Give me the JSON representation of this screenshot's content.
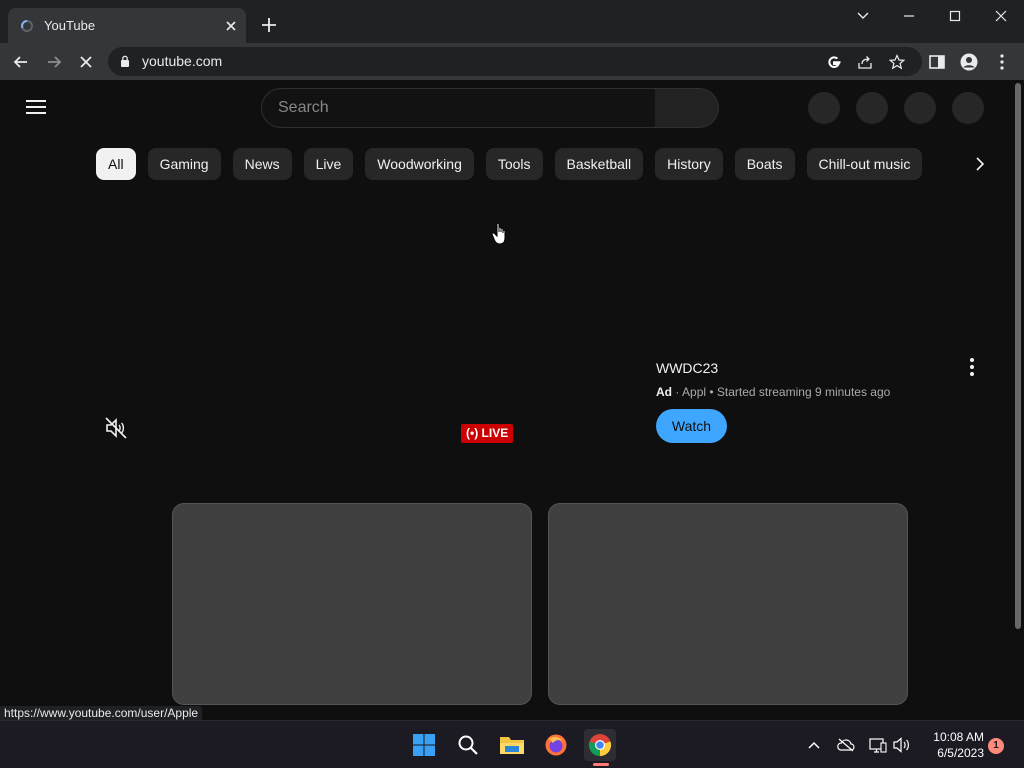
{
  "browser": {
    "tab_title": "YouTube",
    "url": "youtube.com"
  },
  "youtube": {
    "search_placeholder": "Search",
    "chips": [
      "All",
      "Gaming",
      "News",
      "Live",
      "Woodworking",
      "Tools",
      "Basketball",
      "History",
      "Boats",
      "Chill-out music"
    ],
    "active_chip": "All",
    "ad": {
      "title": "WWDC23",
      "label": "Ad",
      "separator": "·",
      "meta": "Appl • Started streaming 9 minutes ago",
      "cta": "Watch"
    },
    "live_badge": "LIVE",
    "colors": {
      "accent": "#3ea6ff",
      "live": "#cc0000"
    }
  },
  "status_bar": {
    "link_url": "https://www.youtube.com/user/Apple"
  },
  "taskbar": {
    "time": "10:08 AM",
    "date": "6/5/2023",
    "notification_count": "1"
  }
}
